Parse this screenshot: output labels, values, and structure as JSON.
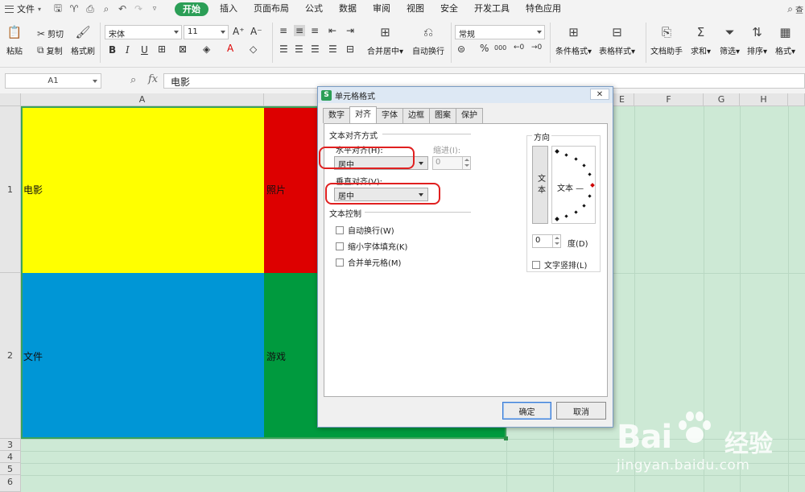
{
  "menu": {
    "file": "文件",
    "items": [
      "开始",
      "插入",
      "页面布局",
      "公式",
      "数据",
      "审阅",
      "视图",
      "安全",
      "开发工具",
      "特色应用"
    ],
    "active": "开始",
    "right_label": "查"
  },
  "ribbon": {
    "paste": "粘贴",
    "cut": "剪切",
    "copy": "复制",
    "format_painter": "格式刷",
    "font_name": "宋体",
    "font_size": "11",
    "bold": "B",
    "italic": "I",
    "underline": "U",
    "merge_center": "合并居中",
    "wrap": "自动换行",
    "number_format": "常规",
    "percent": "%",
    "thousands": "000",
    "conditional_format": "条件格式",
    "table_style": "表格样式",
    "doc_helper": "文档助手",
    "sum": "求和",
    "filter": "筛选",
    "sort": "排序",
    "format": "格式"
  },
  "formula_bar": {
    "name_box": "A1",
    "fx": "fx",
    "value": "电影"
  },
  "grid": {
    "columns": [
      "A",
      "",
      "E",
      "F",
      "G",
      "H"
    ],
    "rows": [
      "1",
      "2",
      "3",
      "4",
      "5",
      "6"
    ],
    "cells": {
      "a1": "电影",
      "b1": "照片",
      "a2": "文件",
      "b2": "游戏"
    },
    "colors": {
      "a1": "#ffff00",
      "b1": "#dd0000",
      "a2": "#0096d6",
      "b2": "#009a3e",
      "sheet_bg": "#cde9d5"
    }
  },
  "dialog": {
    "title": "单元格格式",
    "close": "✕",
    "tabs": [
      "数字",
      "对齐",
      "字体",
      "边框",
      "图案",
      "保护"
    ],
    "active_tab": "对齐",
    "text_alignment_group": "文本对齐方式",
    "horizontal_label": "水平对齐(H):",
    "horizontal_value": "居中",
    "indent_label": "缩进(I):",
    "indent_value": "0",
    "vertical_label": "垂直对齐(V):",
    "vertical_value": "居中",
    "text_control_group": "文本控制",
    "wrap_text": "自动换行(W)",
    "shrink_to_fit": "缩小字体填充(K)",
    "merge_cells": "合并单元格(M)",
    "orientation_group": "方向",
    "vertical_text": "文本",
    "dial_text": "文本 —",
    "degree_value": "0",
    "degree_label": "度(D)",
    "stacked_text": "文字竖排(L)",
    "ok": "确定",
    "cancel": "取消"
  },
  "watermark": {
    "brand": "Bai",
    "brand_cn": "经验",
    "url": "jingyan.baidu.com"
  }
}
